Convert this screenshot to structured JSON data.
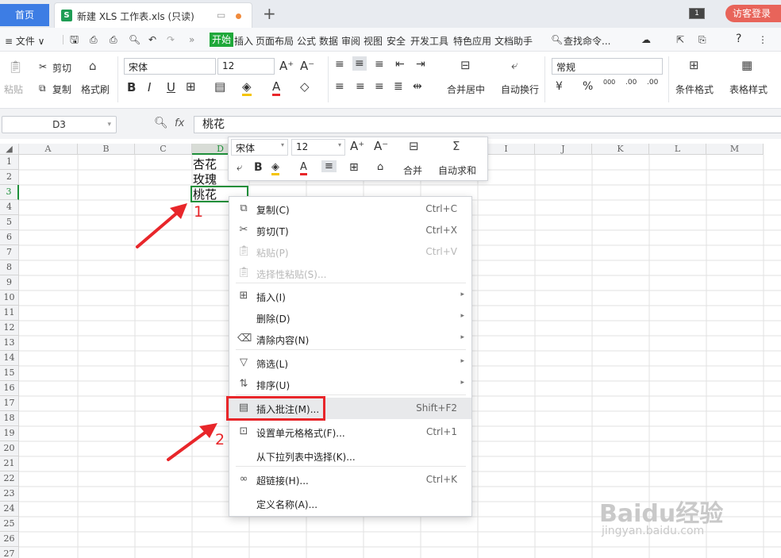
{
  "tabbar": {
    "home": "首页",
    "file_icon": "S",
    "file_title": "新建 XLS 工作表.xls (只读)",
    "new_tab": "+",
    "window_count": "1",
    "visitor_login": "访客登录"
  },
  "menubar": {
    "file": "≡ 文件 ∨",
    "tabs": [
      "开始",
      "插入",
      "页面布局",
      "公式",
      "数据",
      "审阅",
      "视图",
      "安全",
      "开发工具",
      "特色应用",
      "文档助手"
    ],
    "search": "查找命令...",
    "help": "?"
  },
  "ribbon": {
    "paste": "粘贴",
    "cut": "剪切",
    "copy": "复制",
    "format_painter": "格式刷",
    "font_name": "宋体",
    "font_size": "12",
    "number_format": "常规",
    "merge_center": "合并居中",
    "wrap_text": "自动换行",
    "percent": "%",
    "thousands": "000",
    "conditional_format": "条件格式",
    "table_style": "表格样式"
  },
  "formula_bar": {
    "cell_ref": "D3",
    "fx": "fx",
    "content": "桃花"
  },
  "grid": {
    "columns": [
      "A",
      "B",
      "C",
      "D",
      "E",
      "F",
      "G",
      "H",
      "I",
      "J",
      "K",
      "L",
      "M"
    ],
    "rows": [
      "1",
      "2",
      "3",
      "4",
      "5",
      "6",
      "7",
      "8",
      "9",
      "10",
      "11",
      "12",
      "13",
      "14",
      "15",
      "16",
      "17",
      "18",
      "19",
      "20",
      "21",
      "22",
      "23",
      "24",
      "25",
      "26",
      "27"
    ],
    "cells": {
      "D1": "杏花",
      "D2": "玫瑰",
      "D3": "桃花"
    }
  },
  "mini_toolbar": {
    "font_name": "宋体",
    "font_size": "12",
    "bold": "B",
    "merge": "合并",
    "autosum": "自动求和"
  },
  "context_menu": {
    "items": [
      {
        "label": "复制(C)",
        "shortcut": "Ctrl+C",
        "icon": "copy-icon",
        "enabled": true
      },
      {
        "label": "剪切(T)",
        "shortcut": "Ctrl+X",
        "icon": "scissors-icon",
        "enabled": true
      },
      {
        "label": "粘贴(P)",
        "shortcut": "Ctrl+V",
        "icon": "paste-icon",
        "enabled": false
      },
      {
        "label": "选择性粘贴(S)...",
        "shortcut": "",
        "icon": "paste-special-icon",
        "enabled": false
      },
      {
        "label": "插入(I)",
        "shortcut": "",
        "icon": "insert-icon",
        "enabled": true,
        "submenu": true
      },
      {
        "label": "删除(D)",
        "shortcut": "",
        "icon": "",
        "enabled": true,
        "submenu": true
      },
      {
        "label": "清除内容(N)",
        "shortcut": "",
        "icon": "eraser-icon",
        "enabled": true,
        "submenu": true
      },
      {
        "label": "筛选(L)",
        "shortcut": "",
        "icon": "filter-icon",
        "enabled": true,
        "submenu": true
      },
      {
        "label": "排序(U)",
        "shortcut": "",
        "icon": "sort-icon",
        "enabled": true,
        "submenu": true
      },
      {
        "label": "插入批注(M)...",
        "shortcut": "Shift+F2",
        "icon": "comment-icon",
        "enabled": true,
        "highlighted": true
      },
      {
        "label": "设置单元格格式(F)...",
        "shortcut": "Ctrl+1",
        "icon": "format-cells-icon",
        "enabled": true
      },
      {
        "label": "从下拉列表中选择(K)...",
        "shortcut": "",
        "icon": "",
        "enabled": true
      },
      {
        "label": "超链接(H)...",
        "shortcut": "Ctrl+K",
        "icon": "link-icon",
        "enabled": true
      },
      {
        "label": "定义名称(A)...",
        "shortcut": "",
        "icon": "",
        "enabled": true
      }
    ]
  },
  "annotations": {
    "step1": "1",
    "step2": "2",
    "accent": "#e8262a"
  },
  "watermark": {
    "brand": "Baidu经验",
    "url": "jingyan.baidu.com"
  }
}
